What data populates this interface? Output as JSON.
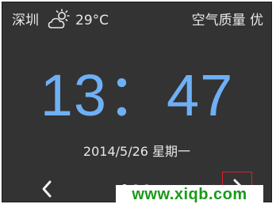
{
  "status": {
    "city": "深圳",
    "weather_icon": "partly-sunny-icon",
    "temperature": "29°C",
    "air_quality": "空气质量 优"
  },
  "clock": {
    "time": "13：47"
  },
  "date": {
    "text": "2014/5/26  星期一"
  },
  "navigation": {
    "prev_icon": "chevron-left-icon",
    "next_icon": "chevron-right-icon",
    "dots_total": 3,
    "dots_active_index": 0
  },
  "watermark": {
    "text": "www.xiqb.com"
  },
  "colors": {
    "screen_background": "#333333",
    "clock_text": "#6fb0f5",
    "primary_text": "#e8e8e8",
    "highlight_box": "#e0202a",
    "watermark_text": "#1a9a1a"
  }
}
